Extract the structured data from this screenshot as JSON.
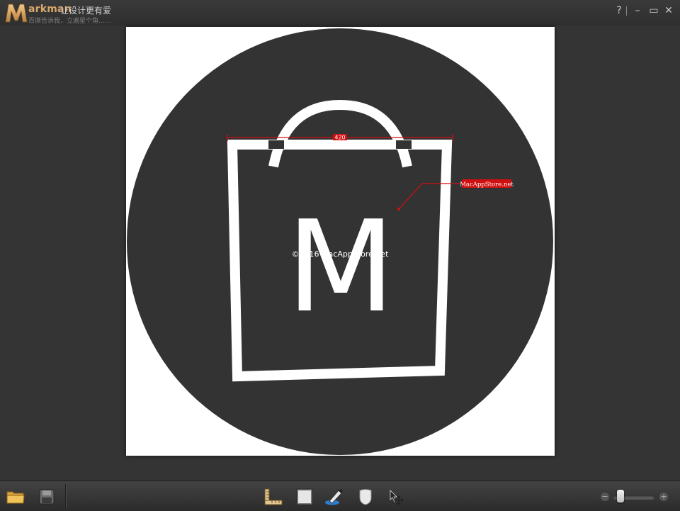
{
  "app": {
    "name": "arkman",
    "logo_letter": "M",
    "slogan": "让设计更有爱",
    "tip": "百撕告诉我，立遍星个角……"
  },
  "window_controls": {
    "help": "?",
    "minimize": "–",
    "maximize": "▭",
    "close": "✕"
  },
  "canvas": {
    "image": {
      "letter": "M",
      "copyright": "©2016 MacAppStore.net",
      "colors": {
        "circle": "#333333",
        "background": "#ffffff",
        "glyph": "#ffffff"
      }
    },
    "annotations": {
      "measure_label": "420",
      "callout_label": "MacAppStore.net",
      "color": "#d01010"
    }
  },
  "toolbar": {
    "tools": [
      {
        "name": "measure-tool",
        "icon": "ruler-icon"
      },
      {
        "name": "color-box-tool",
        "icon": "color-box-icon"
      },
      {
        "name": "pen-tool",
        "icon": "pen-icon"
      },
      {
        "name": "shape-tool",
        "icon": "shield-icon"
      },
      {
        "name": "move-tool",
        "icon": "move-cursor-icon"
      }
    ],
    "zoom": {
      "minus": "−",
      "plus": "+",
      "level": 0.1
    }
  }
}
